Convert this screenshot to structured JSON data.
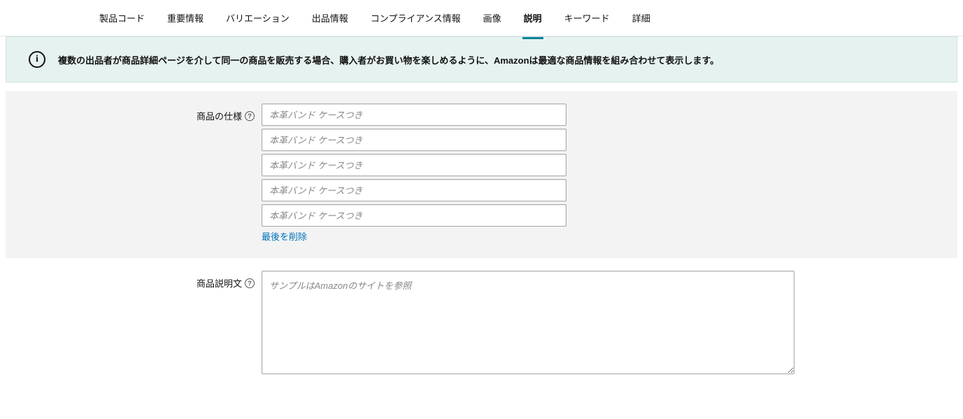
{
  "tabs": [
    {
      "label": "製品コード",
      "active": false
    },
    {
      "label": "重要情報",
      "active": false
    },
    {
      "label": "バリエーション",
      "active": false
    },
    {
      "label": "出品情報",
      "active": false
    },
    {
      "label": "コンプライアンス情報",
      "active": false
    },
    {
      "label": "画像",
      "active": false
    },
    {
      "label": "説明",
      "active": true
    },
    {
      "label": "キーワード",
      "active": false
    },
    {
      "label": "詳細",
      "active": false
    }
  ],
  "info_banner": {
    "text": "複数の出品者が商品詳細ページを介して同一の商品を販売する場合、購入者がお買い物を楽しめるように、Amazonは最適な商品情報を組み合わせて表示します。"
  },
  "spec_section": {
    "label": "商品の仕様",
    "inputs": [
      {
        "placeholder": "本革バンド ケースつき",
        "value": ""
      },
      {
        "placeholder": "本革バンド ケースつき",
        "value": ""
      },
      {
        "placeholder": "本革バンド ケースつき",
        "value": ""
      },
      {
        "placeholder": "本革バンド ケースつき",
        "value": ""
      },
      {
        "placeholder": "本革バンド ケースつき",
        "value": ""
      }
    ],
    "remove_last_label": "最後を削除"
  },
  "description_section": {
    "label": "商品説明文",
    "placeholder": "サンプルはAmazonのサイトを参照",
    "value": ""
  }
}
